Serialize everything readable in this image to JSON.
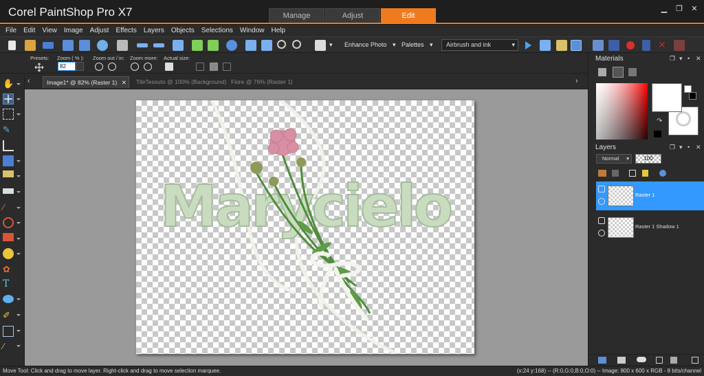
{
  "app": {
    "title": "Corel PaintShop Pro X7"
  },
  "mode_tabs": [
    {
      "label": "Manage",
      "active": false
    },
    {
      "label": "Adjust",
      "active": false
    },
    {
      "label": "Edit",
      "active": true
    }
  ],
  "menu": [
    "File",
    "Edit",
    "View",
    "Image",
    "Adjust",
    "Effects",
    "Layers",
    "Objects",
    "Selections",
    "Window",
    "Help"
  ],
  "toolbar": {
    "enhance_photo": "Enhance Photo",
    "palettes": "Palettes",
    "brush_preset": "Airbrush and ink"
  },
  "tool_options": {
    "presets_label": "Presets:",
    "zoom_label": "Zoom ( % ):",
    "zoom_value": "82",
    "zoom_out_in_label": "Zoom out / in:",
    "zoom_more_label": "Zoom more:",
    "actual_size_label": "Actual size:"
  },
  "documents": [
    {
      "label": "Image1* @  82% (Raster 1)",
      "active": true
    },
    {
      "label": "TileTessuto @ 100% (Background)",
      "active": false
    },
    {
      "label": "Fiore @  76% (Raster 1)",
      "active": false
    }
  ],
  "canvas": {
    "text": "Marycielo",
    "text_color": "#c9dcc0",
    "flower_color": "#d88fa3",
    "stem_color": "#4f8c3b"
  },
  "materials": {
    "title": "Materials"
  },
  "layers": {
    "title": "Layers",
    "blend_mode": "Normal",
    "opacity": "100",
    "items": [
      {
        "name": "Raster 1",
        "selected": true
      },
      {
        "name": "Raster 1 Shadow 1",
        "selected": false
      }
    ]
  },
  "status": {
    "left": "Move Tool: Click and drag to move layer. Right-click and drag to move selection marquee.",
    "right": "(x:24 y:168) -- (R:0,G:0,B:0,O:0) -- Image:  800 x 600 x RGB - 8 bits/channel"
  },
  "colors": {
    "accent": "#f07b1f",
    "selection": "#3399ff"
  }
}
